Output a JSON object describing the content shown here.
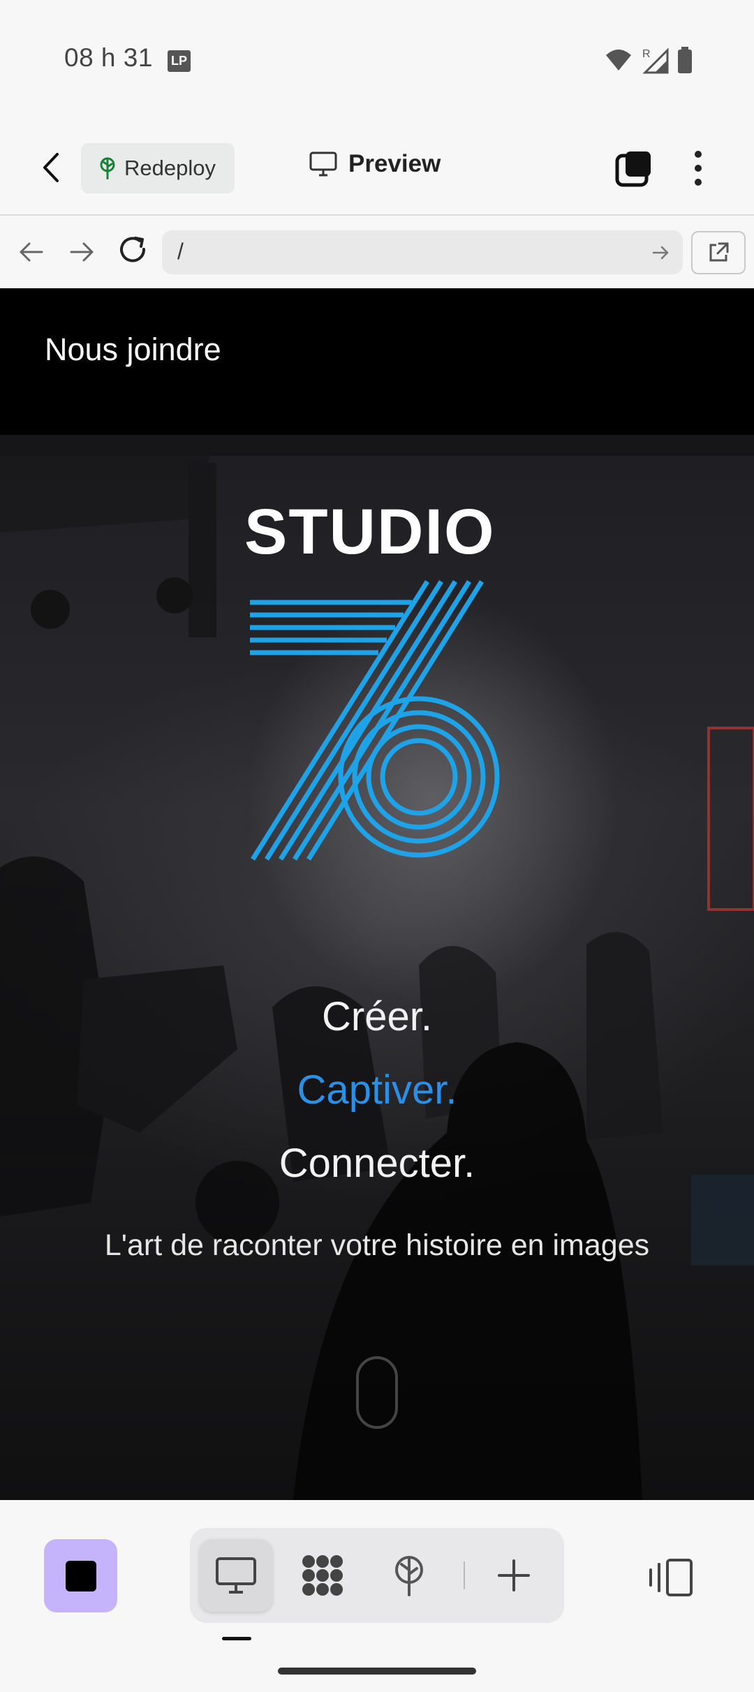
{
  "status_bar": {
    "time": "08 h 31",
    "badge": "LP",
    "network_letter": "R"
  },
  "toolbar": {
    "redeploy_label": "Redeploy",
    "preview_label": "Preview"
  },
  "browser": {
    "url": "/"
  },
  "site": {
    "nav_link": "Nous joindre",
    "logo_text": "STUDIO",
    "logo_number": "76",
    "tagline_1": "Créer.",
    "tagline_2": "Captiver.",
    "tagline_3": "Connecter.",
    "subtitle": "L'art de raconter votre histoire en images"
  },
  "colors": {
    "accent_blue": "#2d8fe3",
    "logo_blue": "#1fa3e8",
    "stop_button": "#c5b3fb"
  },
  "bottom_bar": {
    "items": [
      "monitor-icon",
      "grid-icon",
      "deploy-icon",
      "plus-icon"
    ],
    "active": "monitor-icon"
  }
}
